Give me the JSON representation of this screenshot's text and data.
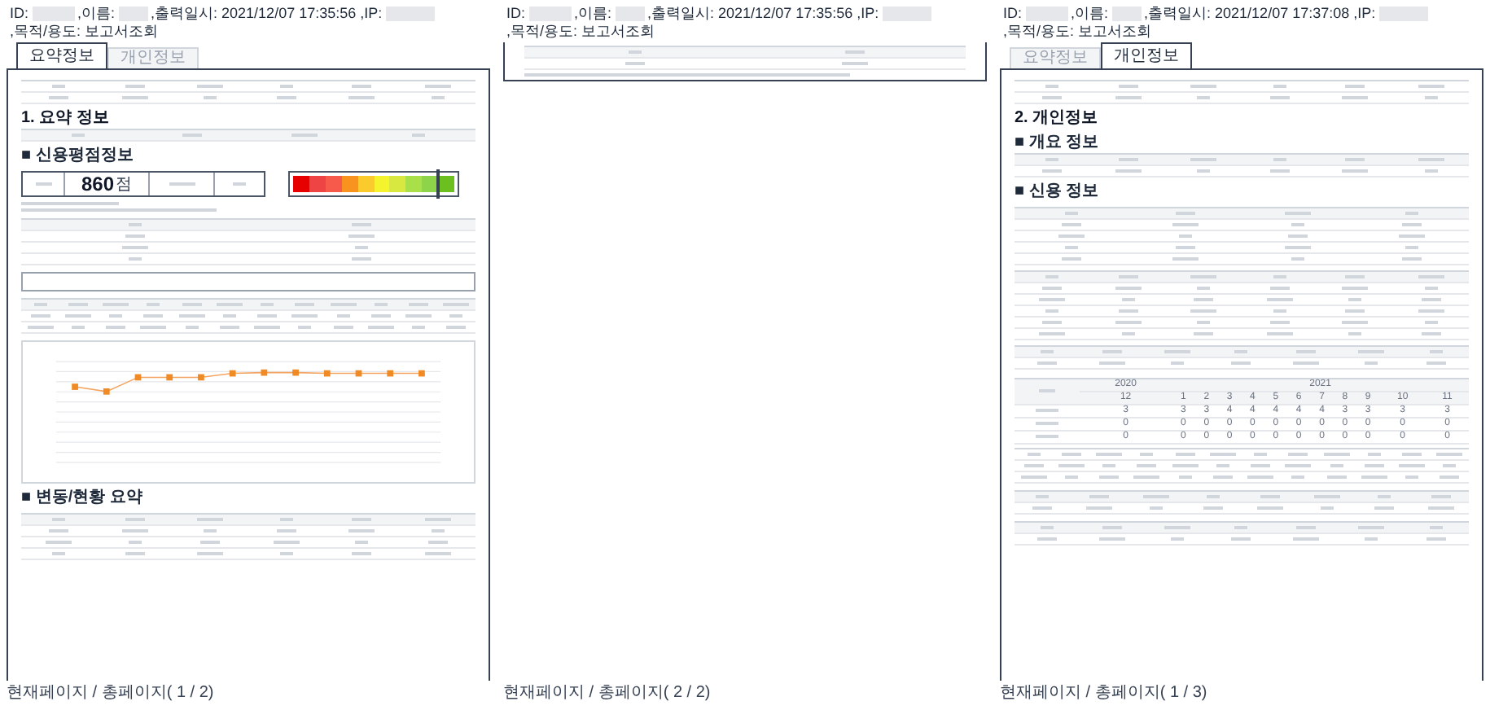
{
  "pages": [
    {
      "kind": "summary",
      "header": [
        "ID:",
        ",이름:",
        ",출력일시: 2021/12/07 17:35:56 ,IP:",
        ",목적/용도: 보고서조회"
      ],
      "tabs": [
        {
          "label": "요약정보",
          "selected": true
        },
        {
          "label": "개인정보",
          "selected": false
        }
      ],
      "title": "1. 요약 정보",
      "sections": [
        "■ 신용평점정보",
        "■ 변동/현황 요약"
      ],
      "score": {
        "value": "860",
        "unit": "점"
      },
      "gauge": {
        "level": 0.87
      },
      "footer": "현재페이지 / 총페이지( 1 / 2)"
    },
    {
      "kind": "continuation",
      "header": [
        "ID:",
        ",이름:",
        ",출력일시: 2021/12/07 17:35:56 ,IP:",
        ",목적/용도: 보고서조회"
      ],
      "footer": "현재페이지 / 총페이지( 2 / 2)"
    },
    {
      "kind": "personal",
      "header": [
        "ID:",
        ",이름:",
        ",출력일시: 2021/12/07 17:37:08 ,IP:",
        ",목적/용도: 보고서조회"
      ],
      "tabs": [
        {
          "label": "요약정보",
          "selected": false
        },
        {
          "label": "개인정보",
          "selected": true
        }
      ],
      "title": "2. 개인정보",
      "sections": [
        "■ 개요 정보",
        "■ 신용 정보"
      ],
      "history": {
        "years": [
          "2020",
          "2021"
        ],
        "months": [
          "12",
          "1",
          "2",
          "3",
          "4",
          "5",
          "6",
          "7",
          "8",
          "9",
          "10",
          "11"
        ],
        "rows": [
          [
            "3",
            "3",
            "3",
            "4",
            "4",
            "4",
            "4",
            "4",
            "3",
            "3",
            "3",
            "3"
          ],
          [
            "0",
            "0",
            "0",
            "0",
            "0",
            "0",
            "0",
            "0",
            "0",
            "0",
            "0",
            "0"
          ],
          [
            "0",
            "0",
            "0",
            "0",
            "0",
            "0",
            "0",
            "0",
            "0",
            "0",
            "0",
            "0"
          ]
        ]
      },
      "footer": "현재페이지 / 총페이지( 1 / 3)"
    }
  ]
}
